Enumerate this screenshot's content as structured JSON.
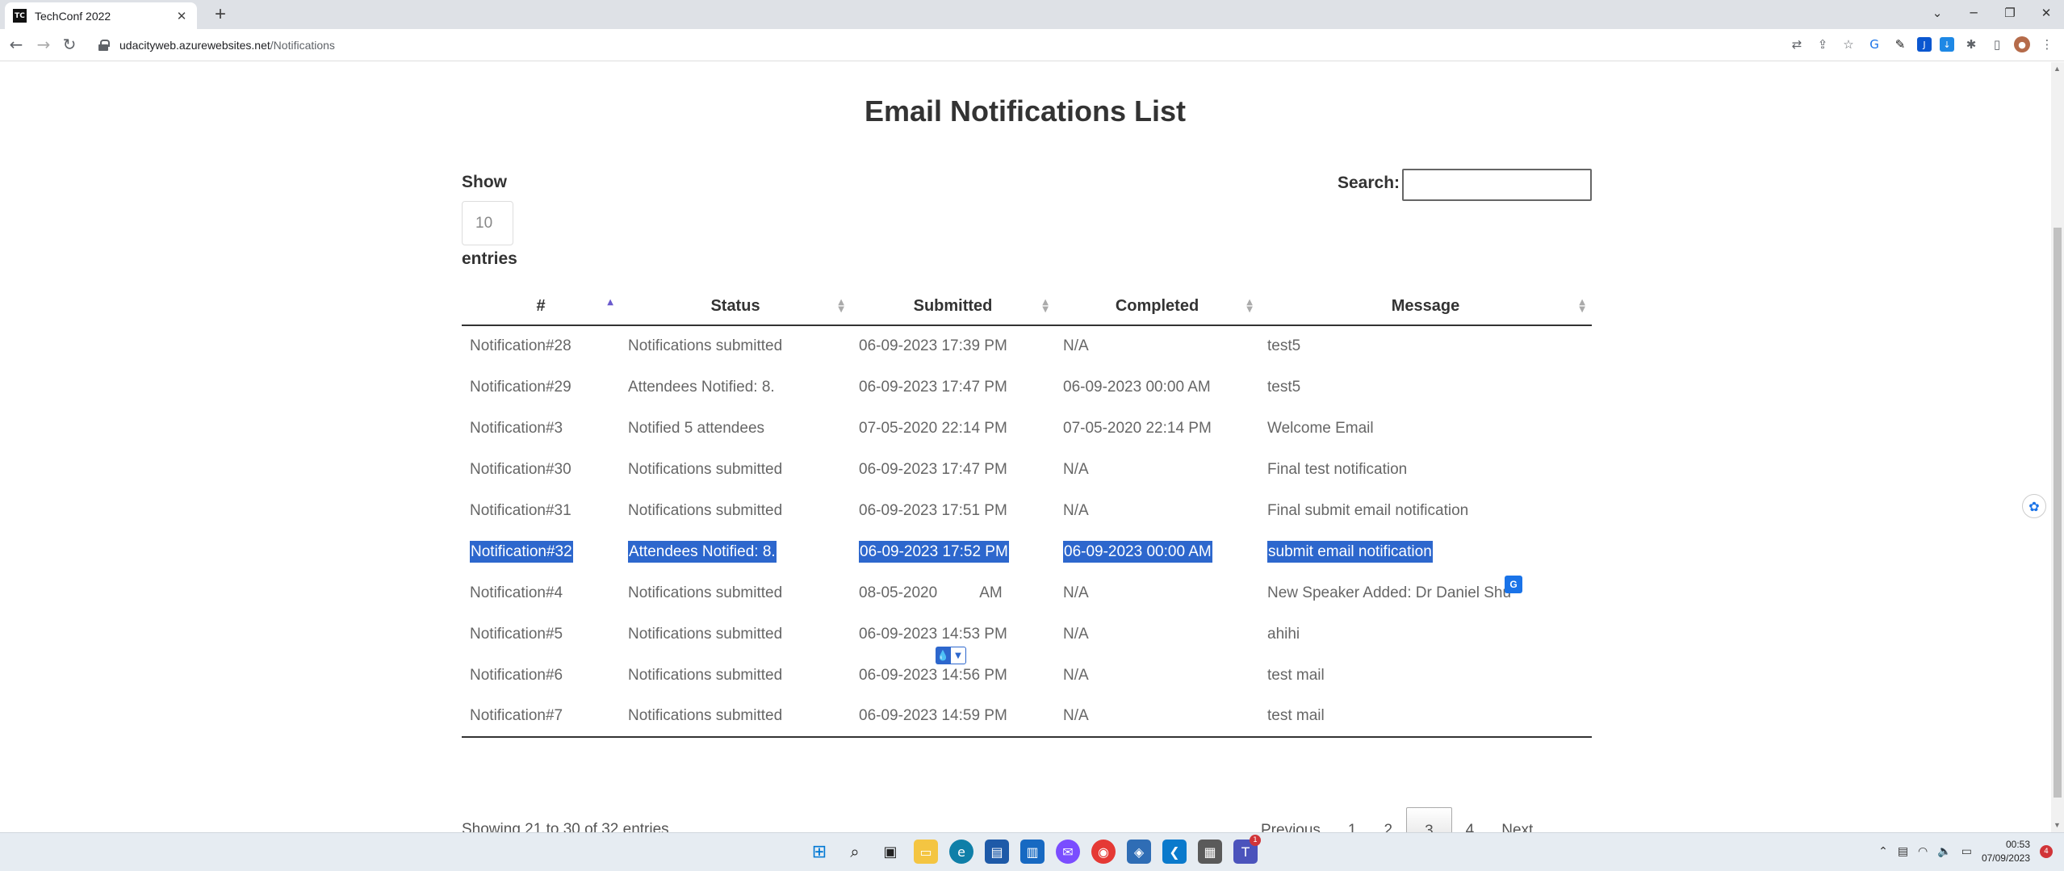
{
  "browser": {
    "tab_title": "TechConf 2022",
    "favicon_text": "TC",
    "url_host": "udacityweb.azurewebsites.net",
    "url_path": "/Notifications"
  },
  "page": {
    "title": "Email Notifications List",
    "show_label": "Show",
    "page_length": "10",
    "entries_label": "entries",
    "search_label": "Search:",
    "search_value": ""
  },
  "table": {
    "columns": [
      "#",
      "Status",
      "Submitted",
      "Completed",
      "Message"
    ],
    "sorted_column": "#",
    "rows": [
      {
        "id": "Notification#28",
        "status": "Notifications submitted",
        "submitted": "06-09-2023 17:39 PM",
        "completed": "N/A",
        "message": "test5"
      },
      {
        "id": "Notification#29",
        "status": "Attendees Notified: 8.",
        "submitted": "06-09-2023 17:47 PM",
        "completed": "06-09-2023 00:00 AM",
        "message": "test5"
      },
      {
        "id": "Notification#3",
        "status": "Notified 5 attendees",
        "submitted": "07-05-2020 22:14 PM",
        "completed": "07-05-2020 22:14 PM",
        "message": "Welcome Email"
      },
      {
        "id": "Notification#30",
        "status": "Notifications submitted",
        "submitted": "06-09-2023 17:47 PM",
        "completed": "N/A",
        "message": "Final test notification"
      },
      {
        "id": "Notification#31",
        "status": "Notifications submitted",
        "submitted": "06-09-2023 17:51 PM",
        "completed": "N/A",
        "message": "Final submit email notification"
      },
      {
        "id": "Notification#32",
        "status": "Attendees Notified: 8.",
        "submitted": "06-09-2023 17:52 PM",
        "completed": "06-09-2023 00:00 AM",
        "message": "submit email notification",
        "selected": true
      },
      {
        "id": "Notification#4",
        "status": "Notifications submitted",
        "submitted_a": "08-05-2020",
        "submitted_b": "AM",
        "completed": "N/A",
        "message": "New Speaker Added: Dr Daniel Shu"
      },
      {
        "id": "Notification#5",
        "status": "Notifications submitted",
        "submitted": "06-09-2023 14:53 PM",
        "completed": "N/A",
        "message": "ahihi"
      },
      {
        "id": "Notification#6",
        "status": "Notifications submitted",
        "submitted": "06-09-2023 14:56 PM",
        "completed": "N/A",
        "message": "test mail"
      },
      {
        "id": "Notification#7",
        "status": "Notifications submitted",
        "submitted": "06-09-2023 14:59 PM",
        "completed": "N/A",
        "message": "test mail"
      }
    ]
  },
  "footer": {
    "info": "Showing 21 to 30 of 32 entries",
    "previous": "Previous",
    "pages": [
      "1",
      "2",
      "3",
      "4"
    ],
    "current_page": "3",
    "next": "Next"
  },
  "taskbar": {
    "time": "00:53",
    "date": "07/09/2023",
    "teams_badge": "1",
    "notif_count": "4"
  },
  "colors": {
    "selection": "#2d67cd",
    "sort_active": "#6a5acd"
  },
  "icons": [
    "start-icon",
    "search-icon",
    "file-explorer-icon",
    "edge-icon",
    "store-icon",
    "messenger-icon",
    "chrome-icon",
    "vscode-icon",
    "calculator-icon",
    "teams-icon"
  ]
}
